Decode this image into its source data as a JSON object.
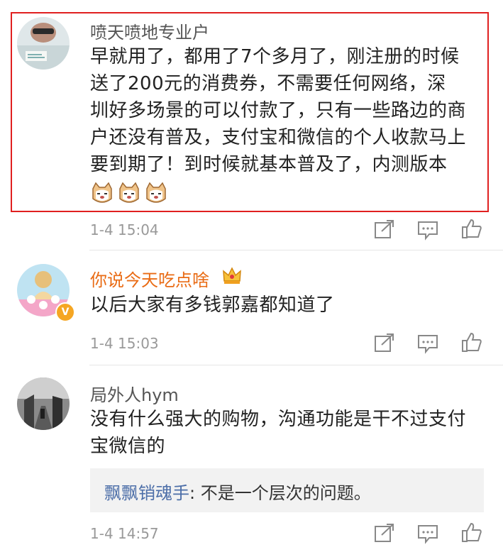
{
  "comments": [
    {
      "author": "喷天喷地专业户",
      "lines": [
        "早就用了，都用了7个多月了，刚注册的时候",
        "送了200元的消费券，不需要任何网络，深",
        "圳好多场景的可以付款了，只有一些路边的商",
        "户还没有普及，支付宝和微信的个人收款马上",
        "要到期了！到时候就基本普及了，内测版本"
      ],
      "emojis": [
        "cat-face-icon",
        "cat-face-icon",
        "cat-face-icon"
      ],
      "time": "1-4 15:04",
      "highlighted": true
    },
    {
      "author": "你说今天吃点啥",
      "author_color": "#e96b14",
      "badge": "crown-icon",
      "verified": "V",
      "lines": [
        "以后大家有多钱郭嘉都知道了"
      ],
      "time": "1-4 15:03"
    },
    {
      "author": "局外人hym",
      "lines": [
        "没有什么强大的购物，沟通功能是干不过支付",
        "宝微信的"
      ],
      "reply": {
        "author": "飘飘销魂手",
        "separator": ": ",
        "text": "不是一个层次的问题。"
      },
      "time": "1-4 14:57"
    }
  ],
  "icons": {
    "share": "share-icon",
    "comment": "comment-icon",
    "like": "thumbs-up-icon"
  },
  "colors": {
    "highlight_border": "#e02020",
    "reply_author": "#4c6ea8",
    "vip_name": "#e96b14"
  }
}
